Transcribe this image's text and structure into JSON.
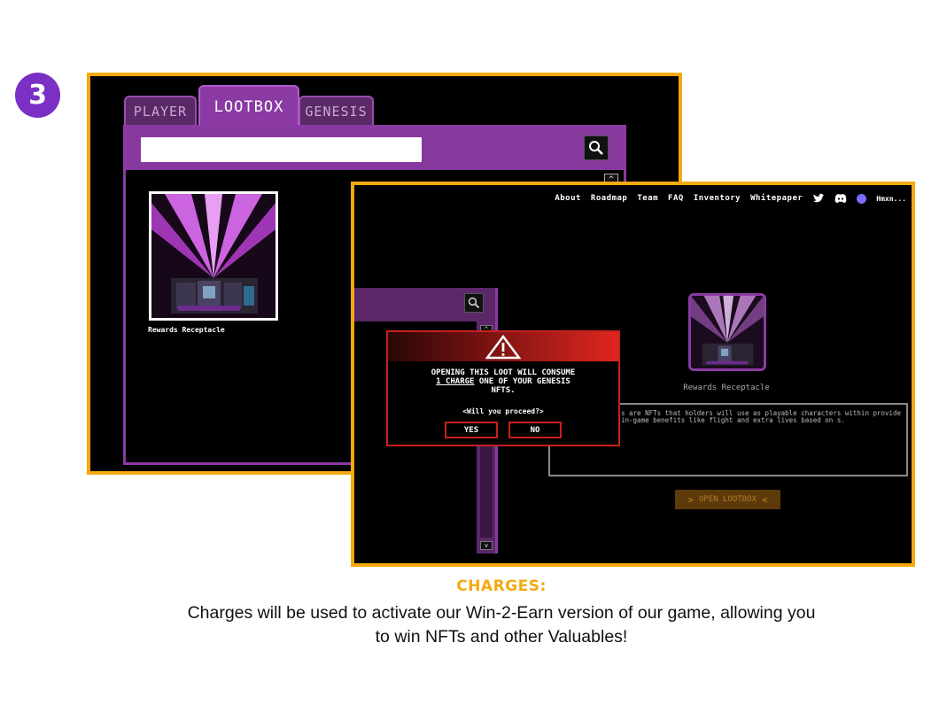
{
  "step_number": "3",
  "back_window": {
    "tabs": [
      {
        "label": "PLAYER"
      },
      {
        "label": "LOOTBOX"
      },
      {
        "label": "GENESIS"
      }
    ],
    "active_tab": "LOOTBOX",
    "search": {
      "value": "",
      "placeholder": ""
    },
    "card_label": "Rewards Receptacle"
  },
  "front_window": {
    "nav": {
      "links": [
        "About",
        "Roadmap",
        "Team",
        "FAQ",
        "Inventory",
        "Whitepaper"
      ],
      "icons": [
        "twitter-icon",
        "discord-icon"
      ],
      "user_name": "Hmxn..."
    },
    "preview_label": "Rewards Receptacle",
    "description": "s are NFTs that holders will use as playable characters within provide in-game benefits like flight and extra lives based on s.",
    "open_button_label": "OPEN LOOTBOX",
    "modal": {
      "title_line1": "OPENING THIS LOOT WILL CONSUME",
      "charge_text": "1 CHARGE",
      "title_line2_rest": " ONE OF YOUR GENESIS",
      "title_line3": "NFTS.",
      "question": "<Will you proceed?>",
      "yes_label": "YES",
      "no_label": "NO"
    }
  },
  "caption": {
    "heading": "CHARGES:",
    "line1": "Charges will be used to activate our Win-2-Earn version of our game, allowing you",
    "line2": "to win NFTs and other Valuables!"
  },
  "colors": {
    "accent_orange": "#f5a90f",
    "purple": "#86389d",
    "badge_purple": "#7b2fc4",
    "alert_red": "#c8201e"
  }
}
